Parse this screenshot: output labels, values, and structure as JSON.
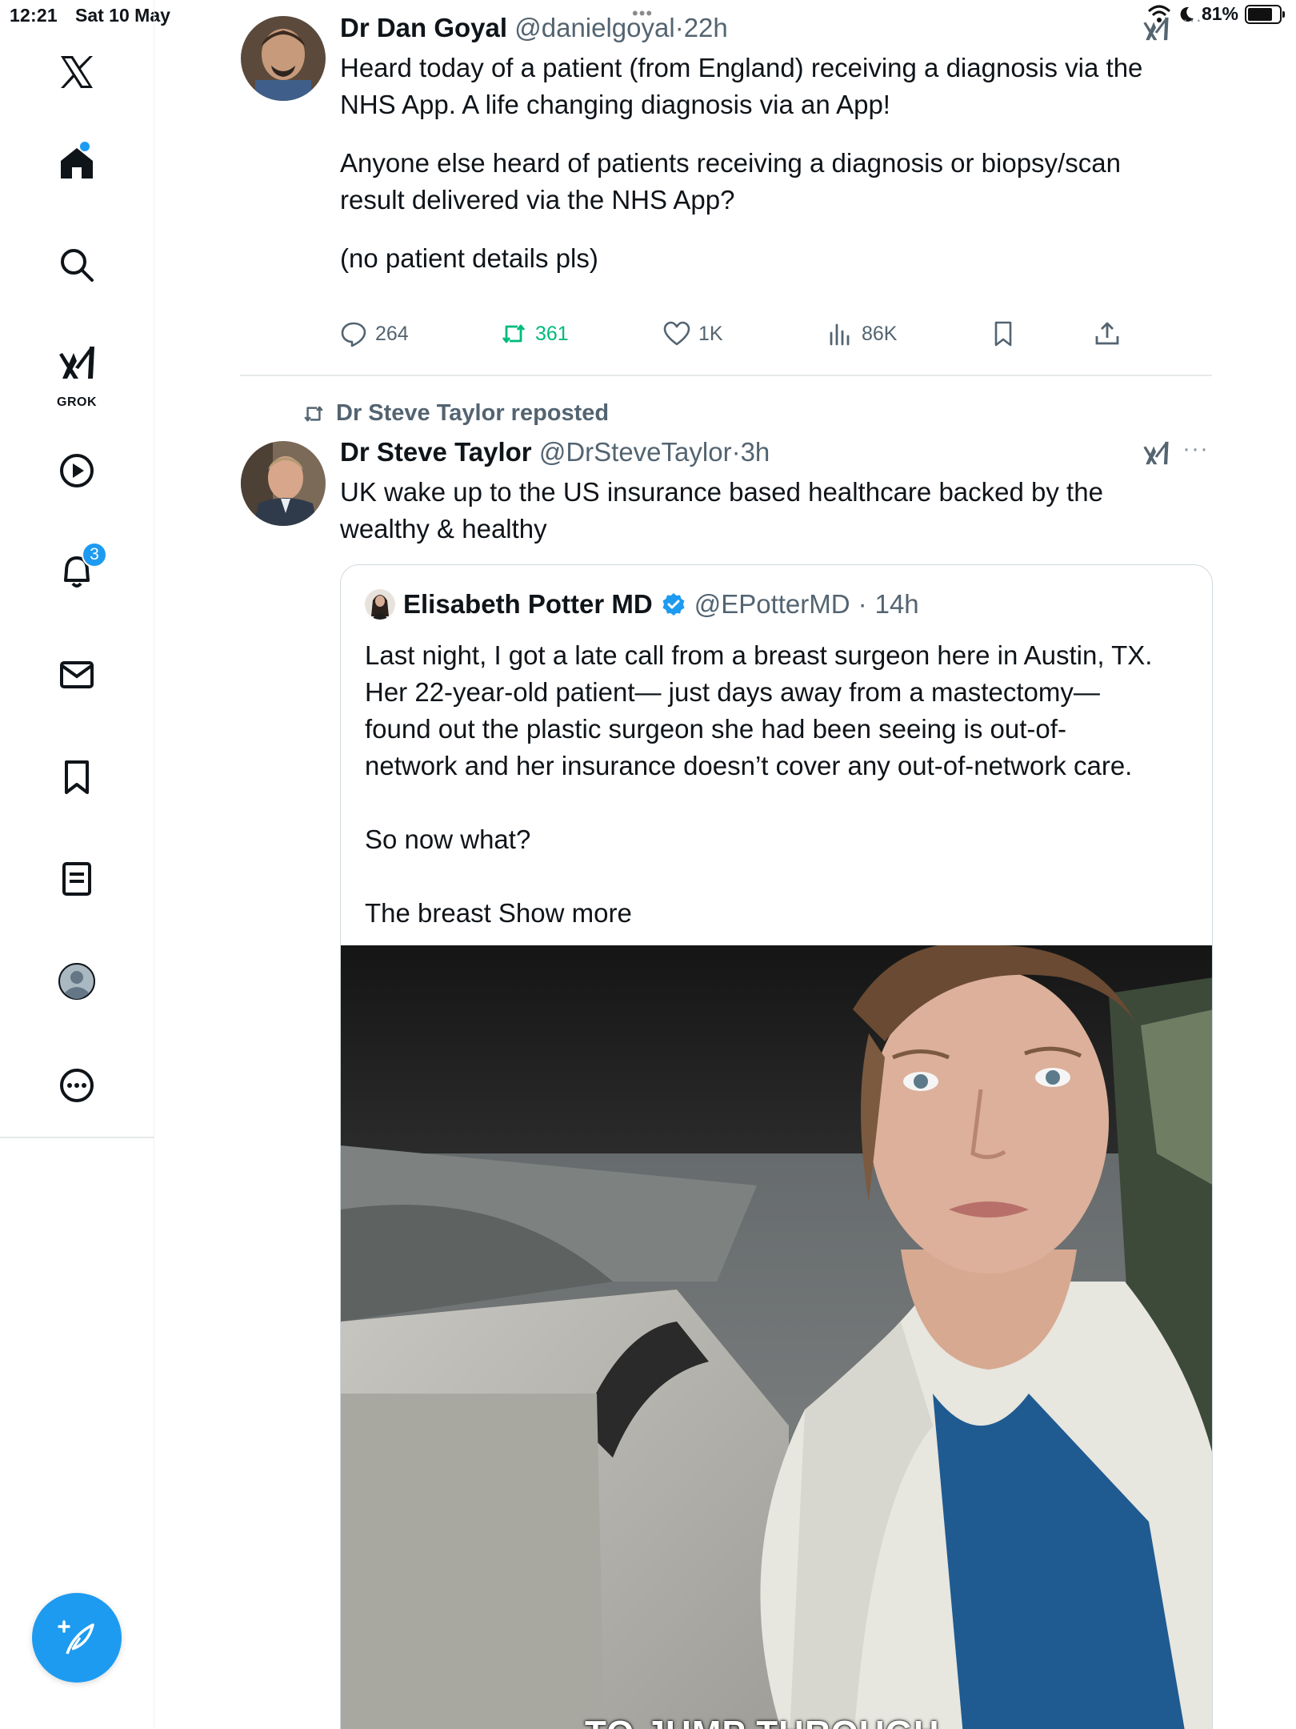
{
  "status_bar": {
    "time": "12:21",
    "date": "Sat 10 May",
    "battery": "81%",
    "top_dots": "•••"
  },
  "sidebar": {
    "items": [
      {
        "name": "x-logo"
      },
      {
        "name": "home"
      },
      {
        "name": "explore"
      },
      {
        "name": "grok",
        "label": "GROK"
      },
      {
        "name": "videos"
      },
      {
        "name": "notifications",
        "badge": "3"
      },
      {
        "name": "messages"
      },
      {
        "name": "bookmarks"
      },
      {
        "name": "lists"
      },
      {
        "name": "profile"
      },
      {
        "name": "more"
      }
    ],
    "accent": "#1d9bf0"
  },
  "tweet1": {
    "name": "Dr Dan Goyal",
    "handle": "@danielgoyal",
    "sep": "·",
    "time": "22h",
    "line1": "Heard today of a patient (from England) receiving a diagnosis via the",
    "line2": "NHS App. A life changing diagnosis via an App!",
    "line3": "Anyone else heard of patients receiving a diagnosis or biopsy/scan",
    "line4": "result delivered via the NHS App?",
    "line5": "(no patient details pls)",
    "replies": "264",
    "reposts": "361",
    "likes": "1K",
    "views": "86K"
  },
  "tweet2": {
    "reposted_by": "Dr Steve Taylor reposted",
    "name": "Dr Steve Taylor",
    "handle": "@DrSteveTaylor",
    "sep": "·",
    "time": "3h",
    "line1": "UK wake up to the US insurance based healthcare backed by the",
    "line2": "wealthy & healthy",
    "more": "···"
  },
  "quote": {
    "name": "Elisabeth Potter MD",
    "handle": "@EPotterMD",
    "sep": "·",
    "time": "14h",
    "line1": "Last night, I got a late call from a breast surgeon here in Austin, TX.",
    "line2": "Her 22-year-old patient— just days away from a mastectomy—",
    "line3": "found out the plastic surgeon she had been seeing is out-of-",
    "line4": "network and her insurance doesn’t cover any out-of-network care.",
    "line5": "So now what?",
    "line6": "The breast",
    "show_more": "Show more",
    "video_caption": "TO JUMP THROUGH"
  }
}
